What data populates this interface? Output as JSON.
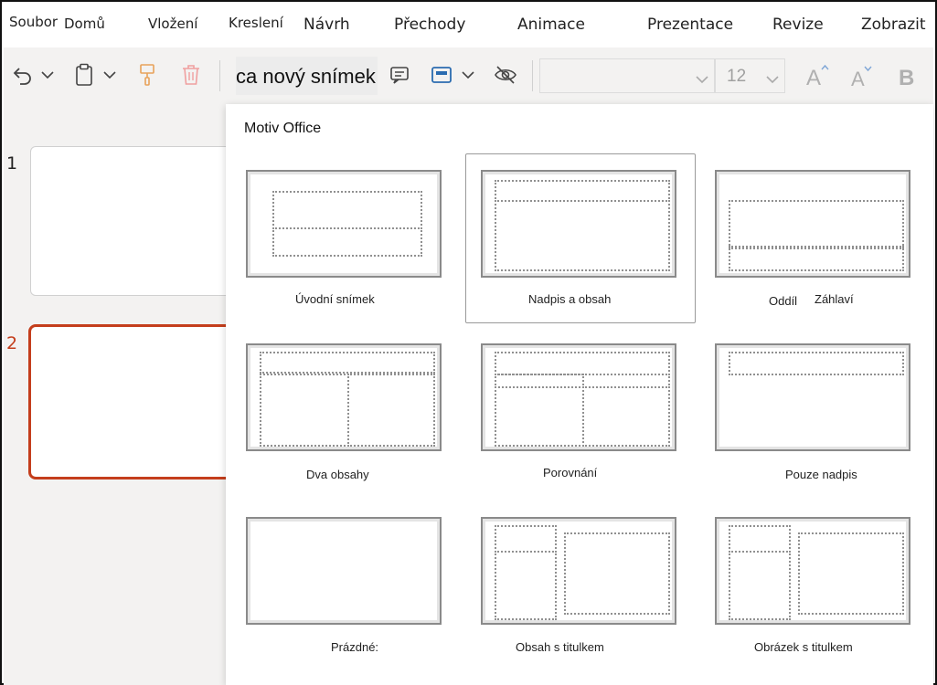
{
  "menu": {
    "file": "Soubor",
    "home": "Domů",
    "insert": "Vložení",
    "draw": "Kreslení",
    "design": "Návrh",
    "transitions": "Přechody",
    "animations": "Animace",
    "slideshow": "Prezentace",
    "review": "Revize",
    "view": "Zobrazit"
  },
  "toolbar": {
    "new_slide_label": "ca nový snímek",
    "font_size": "12",
    "font_name": "",
    "icons": [
      "undo-icon",
      "clipboard-icon",
      "format-painter-icon",
      "delete-icon",
      "comment-icon",
      "layout-icon",
      "hide-icon",
      "grow-font-icon",
      "shrink-font-icon",
      "bold-icon"
    ]
  },
  "slides": {
    "items": [
      {
        "number": "1",
        "selected": false
      },
      {
        "number": "2",
        "selected": true
      }
    ],
    "accent_color": "#c43e1c"
  },
  "gallery": {
    "section_title": "Motiv Office",
    "selected_layout": "Nadpis a obsah",
    "layouts": [
      {
        "label": "Úvodní snímek"
      },
      {
        "label": "Nadpis a obsah"
      },
      {
        "label": "Oddíl",
        "label_extra": "Záhlaví"
      },
      {
        "label": "Dva obsahy"
      },
      {
        "label": "Porovnání"
      },
      {
        "label": "Pouze nadpis"
      },
      {
        "label": "Prázdné:"
      },
      {
        "label": "Obsah s titulkem"
      },
      {
        "label": "Obrázek s titulkem"
      }
    ]
  }
}
